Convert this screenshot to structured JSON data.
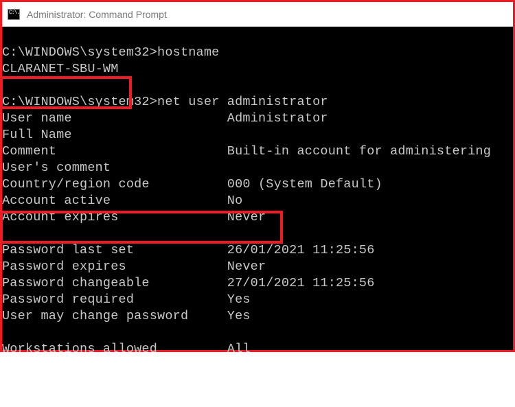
{
  "window": {
    "title": "Administrator: Command Prompt",
    "icon_label": "C:\\."
  },
  "terminal": {
    "prompt_path": "C:\\WINDOWS\\system32>",
    "cmd1": "hostname",
    "hostname_output": "CLARANET-SBU-WM",
    "cmd2": "net user administrator",
    "rows": {
      "user_name": {
        "label": "User name",
        "value": "Administrator"
      },
      "full_name": {
        "label": "Full Name",
        "value": ""
      },
      "comment": {
        "label": "Comment",
        "value": "Built-in account for administering"
      },
      "users_comment": {
        "label": "User's comment",
        "value": ""
      },
      "country": {
        "label": "Country/region code",
        "value": "000 (System Default)"
      },
      "account_active": {
        "label": "Account active",
        "value": "No"
      },
      "account_expires": {
        "label": "Account expires",
        "value": "Never"
      },
      "pwd_last_set": {
        "label": "Password last set",
        "value": "26/01/2021 11:25:56"
      },
      "pwd_expires": {
        "label": "Password expires",
        "value": "Never"
      },
      "pwd_changeable": {
        "label": "Password changeable",
        "value": "27/01/2021 11:25:56"
      },
      "pwd_required": {
        "label": "Password required",
        "value": "Yes"
      },
      "user_may_change": {
        "label": "User may change password",
        "value": "Yes"
      },
      "workstations": {
        "label": "Workstations allowed",
        "value": "All"
      }
    }
  }
}
